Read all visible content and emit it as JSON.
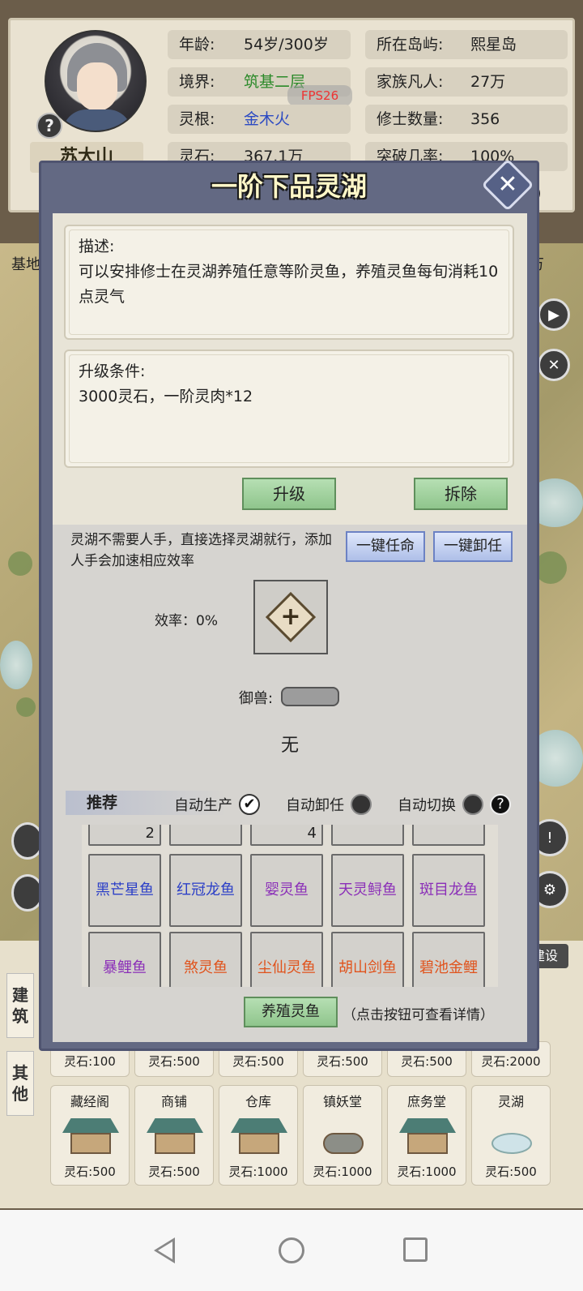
{
  "player": {
    "name": "苏大山",
    "age_label": "年龄:",
    "age_value": "54岁/300岁",
    "realm_label": "境界:",
    "realm_value": "筑基二层",
    "root_label": "灵根:",
    "root_value": "金木火",
    "stone_label": "灵石:",
    "stone_value": "367.1万",
    "island_label": "所在岛屿:",
    "island_value": "熙星岛",
    "family_label": "家族凡人:",
    "family_value": "27万",
    "cultivators_label": "修士数量:",
    "cultivators_value": "356",
    "breakthrough_label": "突破几率:",
    "breakthrough_value": "100%",
    "fps": "FPS26"
  },
  "peeks": {
    "left_top": "基地",
    "right_top": "万",
    "right_partial": "6)"
  },
  "modal": {
    "title": "一阶下品灵湖",
    "close_icon": "✕",
    "desc_title": "描述:",
    "desc_text": "可以安排修士在灵湖养殖任意等阶灵鱼，养殖灵鱼每旬消耗10点灵气",
    "upgrade_title": "升级条件:",
    "upgrade_text": "3000灵石，一阶灵肉*12",
    "upgrade_btn": "升级",
    "demolish_btn": "拆除",
    "note": "灵湖不需要人手，直接选择灵湖就行，添加人手会加速相应效率",
    "assign_btn": "一键任命",
    "unassign_btn": "一键卸任",
    "efficiency": "效率：0%",
    "beast_label": "御兽:",
    "none_text": "无",
    "recommend_tab": "推荐",
    "opt_auto_produce": "自动生产",
    "opt_auto_unassign": "自动卸任",
    "opt_auto_switch": "自动切换",
    "check_mark": "✔",
    "help_mark": "?",
    "top_counts": [
      "2",
      "",
      "4",
      "",
      ""
    ],
    "fish_row1": [
      "黑芒星鱼",
      "红冠龙鱼",
      "婴灵鱼",
      "天灵鲟鱼",
      "斑目龙鱼"
    ],
    "fish_row2": [
      "暴鲤鱼",
      "煞灵鱼",
      "尘仙灵鱼",
      "胡山剑鱼",
      "碧池金鲤"
    ],
    "breed_btn": "养殖灵鱼",
    "breed_hint": "（点击按钮可查看详情）"
  },
  "build": {
    "tab_build": [
      "建",
      "筑"
    ],
    "tab_other": [
      "其",
      "他"
    ],
    "label": "建设",
    "row1_costs": [
      "灵石:100",
      "灵石:500",
      "灵石:500",
      "灵石:500",
      "灵石:500",
      "灵石:2000"
    ],
    "row2": [
      {
        "name": "藏经阁",
        "cost": "灵石:500"
      },
      {
        "name": "商铺",
        "cost": "灵石:500"
      },
      {
        "name": "仓库",
        "cost": "灵石:1000"
      },
      {
        "name": "镇妖堂",
        "cost": "灵石:1000"
      },
      {
        "name": "庶务堂",
        "cost": "灵石:1000"
      },
      {
        "name": "灵湖",
        "cost": "灵石:500"
      }
    ]
  }
}
